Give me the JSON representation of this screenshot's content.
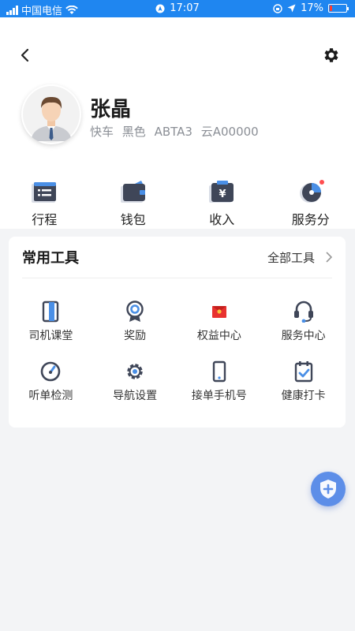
{
  "status_bar": {
    "carrier": "中国电信",
    "time": "17:07",
    "battery": "17%",
    "battery_level": 0.17,
    "icons": [
      "signal-icon",
      "wifi-icon",
      "location-arrow-icon",
      "orientation-lock-icon",
      "battery-icon"
    ]
  },
  "header": {
    "back_icon": "chevron-left-icon",
    "settings_icon": "gear-icon"
  },
  "profile": {
    "name": "张晶",
    "car_type": "快车",
    "car_color": "黑色",
    "plate": "ABTA3",
    "code": "云A00000"
  },
  "quick_menu": [
    {
      "label": "行程",
      "icon": "itinerary-list-icon"
    },
    {
      "label": "钱包",
      "icon": "wallet-icon"
    },
    {
      "label": "收入",
      "icon": "income-yuan-icon"
    },
    {
      "label": "服务分",
      "icon": "service-score-pie-icon",
      "badge": true
    }
  ],
  "tools": {
    "title": "常用工具",
    "all_label": "全部工具",
    "items": [
      {
        "label": "司机课堂",
        "icon": "book-icon"
      },
      {
        "label": "奖励",
        "icon": "award-medal-icon"
      },
      {
        "label": "权益中心",
        "icon": "red-envelope-icon"
      },
      {
        "label": "服务中心",
        "icon": "headset-icon"
      },
      {
        "label": "听单检测",
        "icon": "gauge-icon"
      },
      {
        "label": "导航设置",
        "icon": "gear-icon"
      },
      {
        "label": "接单手机号",
        "icon": "phone-icon"
      },
      {
        "label": "健康打卡",
        "icon": "calendar-check-icon"
      }
    ]
  },
  "colors": {
    "status_bar": "#1f86f0",
    "icon_dark": "#3f4658",
    "icon_accent": "#4a8fe6",
    "badge": "#ff4d4f",
    "fab": "#5d8ee8"
  }
}
